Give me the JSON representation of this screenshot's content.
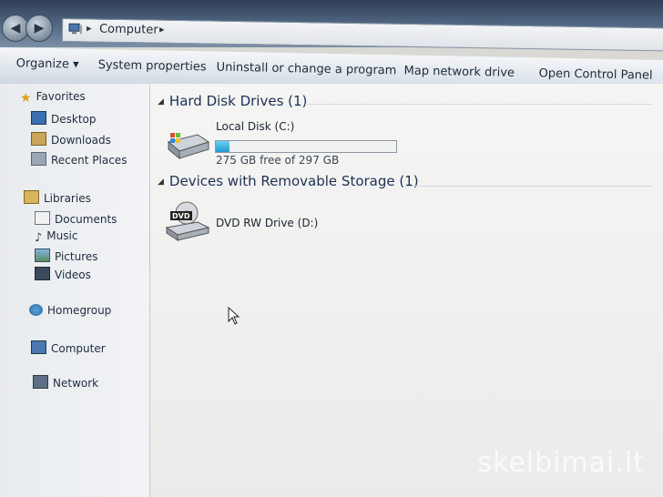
{
  "address_bar": {
    "breadcrumb": "Computer"
  },
  "toolbar": {
    "organize": "Organize ▾",
    "system_properties": "System properties",
    "uninstall": "Uninstall or change a program",
    "map_network_drive": "Map network drive",
    "open_control_panel": "Open Control Panel"
  },
  "nav": {
    "favorites": "Favorites",
    "desktop": "Desktop",
    "downloads": "Downloads",
    "recent_places": "Recent Places",
    "libraries": "Libraries",
    "documents": "Documents",
    "music": "Music",
    "pictures": "Pictures",
    "videos": "Videos",
    "homegroup": "Homegroup",
    "computer": "Computer",
    "network": "Network"
  },
  "content": {
    "hdd_header": "Hard Disk Drives (1)",
    "removable_header": "Devices with Removable Storage (1)",
    "local_disk": {
      "name": "Local Disk (C:)",
      "free_text": "275 GB free of 297 GB",
      "used_fraction": 0.074
    },
    "dvd_drive": {
      "name": "DVD RW Drive (D:)",
      "icon_text": "DVD"
    }
  },
  "watermark": "skelbimai.lt",
  "colors": {
    "accent_capacity": "#1f9ad2",
    "header_text": "#1e3152"
  }
}
